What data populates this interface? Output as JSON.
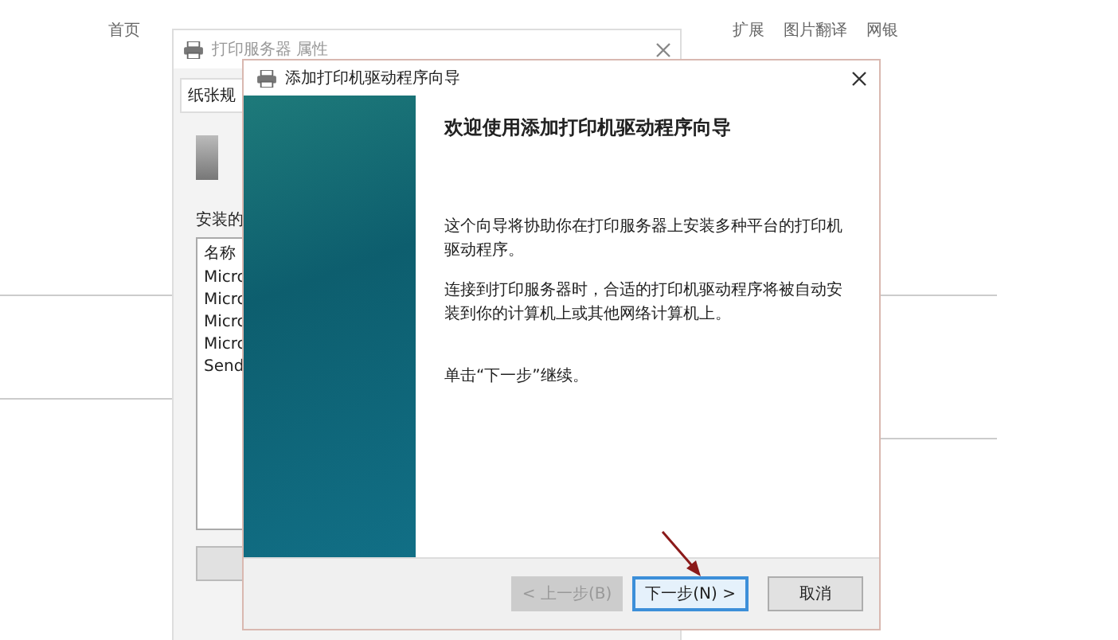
{
  "browser_toolbar": {
    "left_items": [
      "首页"
    ],
    "right_items": [
      "扩展",
      "图片翻译",
      "网银"
    ]
  },
  "background_window": {
    "title": "打印服务器 属性",
    "tab": "纸张规",
    "list_label": "安装的",
    "list_items": [
      "名称",
      "Micrc",
      "Micrc",
      "Micrc",
      "Micrc",
      "Send"
    ]
  },
  "wizard": {
    "title": "添加打印机驱动程序向导",
    "heading": "欢迎使用添加打印机驱动程序向导",
    "paragraphs": [
      "这个向导将协助你在打印服务器上安装多种平台的打印机驱动程序。",
      "连接到打印服务器时，合适的打印机驱动程序将被自动安装到你的计算机上或其他网络计算机上。",
      "单击“下一步”继续。"
    ],
    "buttons": [
      {
        "label": "< 上一步(B)",
        "disabled": true,
        "focused": false
      },
      {
        "label": "下一步(N) >",
        "disabled": false,
        "focused": true
      },
      {
        "label": "取消",
        "disabled": false,
        "focused": false
      }
    ]
  }
}
